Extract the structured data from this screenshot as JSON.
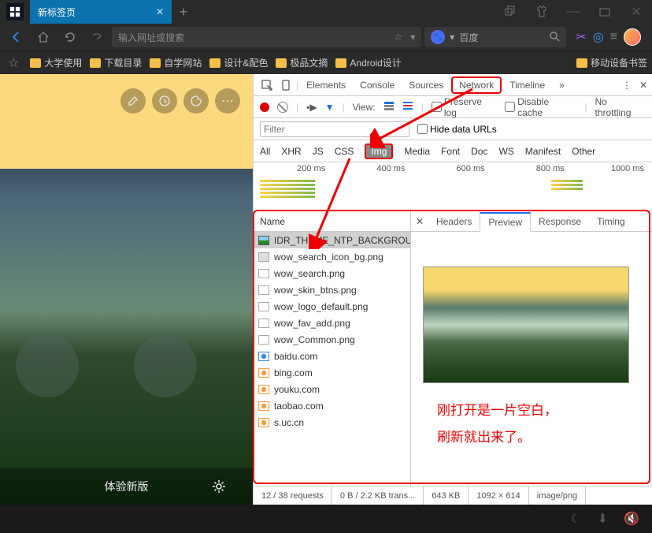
{
  "titlebar": {
    "tab_title": "新标签页"
  },
  "navbar": {
    "addr_placeholder": "输入网址或搜索",
    "search_engine": "百度"
  },
  "bookmarks": {
    "items": [
      "大学使用",
      "下载目录",
      "自学网站",
      "设计&配色",
      "极品文摘",
      "Android设计"
    ],
    "right": "移动设备书签"
  },
  "left": {
    "experience": "体验新版"
  },
  "devtools": {
    "tabs": {
      "elements": "Elements",
      "console": "Console",
      "sources": "Sources",
      "network": "Network",
      "timeline": "Timeline"
    },
    "toolbar": {
      "view": "View:",
      "preserve": "Preserve log",
      "disable": "Disable cache",
      "throttle": "No throttling"
    },
    "filter": {
      "placeholder": "Filter",
      "hide": "Hide data URLs"
    },
    "types": {
      "all": "All",
      "xhr": "XHR",
      "js": "JS",
      "css": "CSS",
      "img": "Img",
      "media": "Media",
      "font": "Font",
      "doc": "Doc",
      "ws": "WS",
      "manifest": "Manifest",
      "other": "Other"
    },
    "timeline": {
      "t1": "200 ms",
      "t2": "400 ms",
      "t3": "600 ms",
      "t4": "800 ms",
      "t5": "1000 ms"
    },
    "name_header": "Name",
    "requests": [
      {
        "icon": "green",
        "name": "IDR_THEME_NTP_BACKGROUN..."
      },
      {
        "icon": "gray",
        "name": "wow_search_icon_bg.png"
      },
      {
        "icon": "plain",
        "name": "wow_search.png"
      },
      {
        "icon": "plain",
        "name": "wow_skin_btns.png"
      },
      {
        "icon": "plain",
        "name": "wow_logo_default.png"
      },
      {
        "icon": "plain",
        "name": "wow_fav_add.png"
      },
      {
        "icon": "plain",
        "name": "wow_Common.png"
      },
      {
        "icon": "blue",
        "name": "baidu.com"
      },
      {
        "icon": "orange",
        "name": "bing.com"
      },
      {
        "icon": "orange",
        "name": "youku.com"
      },
      {
        "icon": "orange",
        "name": "taobao.com"
      },
      {
        "icon": "orange",
        "name": "s.uc.cn"
      }
    ],
    "preview_tabs": {
      "headers": "Headers",
      "preview": "Preview",
      "response": "Response",
      "timing": "Timing"
    },
    "annotation": {
      "line1": "刚打开是一片空白，",
      "line2": "刷新就出来了。"
    },
    "status": {
      "req": "12 / 38 requests",
      "trans": "0 B / 2.2 KB trans...",
      "size": "643 KB",
      "dim": "1092 × 614",
      "type": "image/png"
    }
  }
}
